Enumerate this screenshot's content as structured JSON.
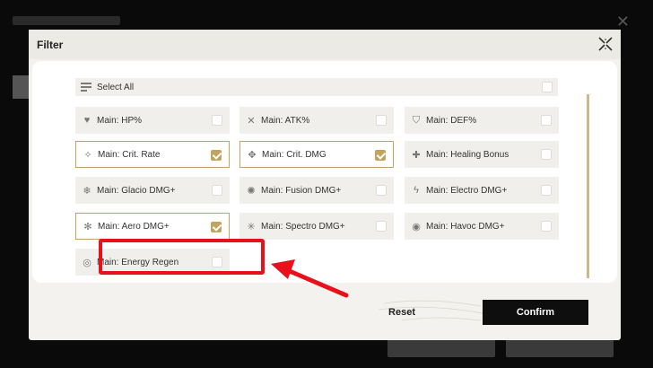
{
  "dialog": {
    "title": "Filter",
    "select_all_label": "Select All",
    "reset_label": "Reset",
    "confirm_label": "Confirm"
  },
  "options": [
    {
      "label": "Main: HP%",
      "checked": false,
      "icon": "hp-icon"
    },
    {
      "label": "Main: ATK%",
      "checked": false,
      "icon": "atk-icon"
    },
    {
      "label": "Main: DEF%",
      "checked": false,
      "icon": "def-icon"
    },
    {
      "label": "Main: Crit. Rate",
      "checked": true,
      "icon": "crit-rate-icon"
    },
    {
      "label": "Main: Crit. DMG",
      "checked": true,
      "icon": "crit-dmg-icon"
    },
    {
      "label": "Main: Healing Bonus",
      "checked": false,
      "icon": "healing-icon"
    },
    {
      "label": "Main: Glacio DMG+",
      "checked": false,
      "icon": "glacio-icon"
    },
    {
      "label": "Main: Fusion DMG+",
      "checked": false,
      "icon": "fusion-icon"
    },
    {
      "label": "Main: Electro DMG+",
      "checked": false,
      "icon": "electro-icon"
    },
    {
      "label": "Main: Aero DMG+",
      "checked": true,
      "icon": "aero-icon"
    },
    {
      "label": "Main: Spectro DMG+",
      "checked": false,
      "icon": "spectro-icon"
    },
    {
      "label": "Main: Havoc DMG+",
      "checked": false,
      "icon": "havoc-icon"
    },
    {
      "label": "Main: Energy Regen",
      "checked": false,
      "icon": "energy-regen-icon"
    }
  ],
  "colors": {
    "accent": "#c0a460",
    "highlight": "#e8101a",
    "confirm_bg": "#0e0e0e"
  }
}
